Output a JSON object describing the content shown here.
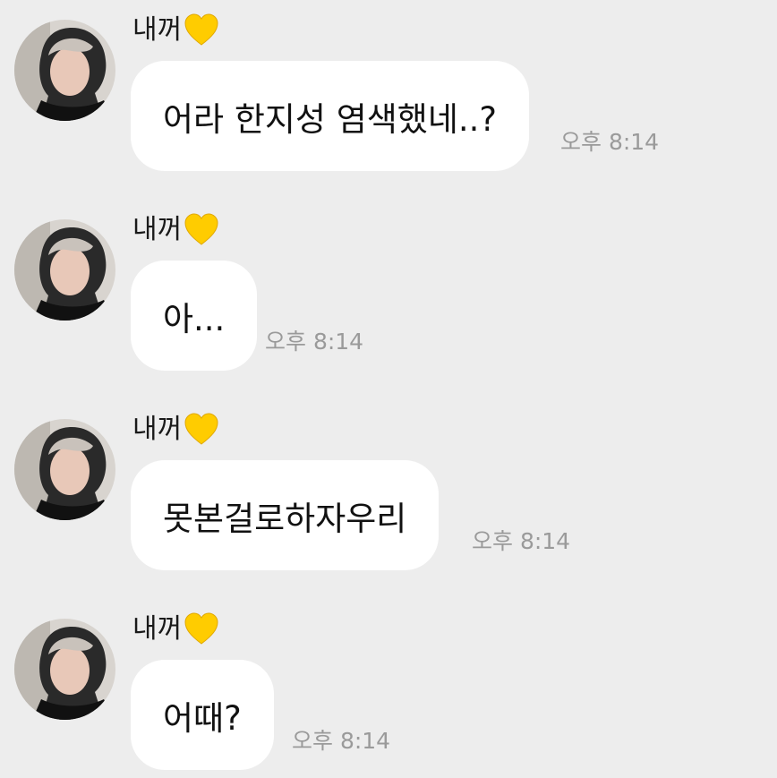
{
  "messages": [
    {
      "sender": "내꺼",
      "text": "어라 한지성 염색했네..?",
      "time": "오후 8:14"
    },
    {
      "sender": "내꺼",
      "text": "아...",
      "time": "오후 8:14"
    },
    {
      "sender": "내꺼",
      "text": "못본걸로하자우리",
      "time": "오후 8:14"
    },
    {
      "sender": "내꺼",
      "text": "어때?",
      "time": "오후 8:14"
    }
  ],
  "icons": {
    "heart": "yellow-heart-icon",
    "avatar": "profile-photo"
  },
  "colors": {
    "background": "#ededed",
    "bubble": "#ffffff",
    "time_text": "#9a9a9a",
    "heart": "#ffcc00"
  }
}
